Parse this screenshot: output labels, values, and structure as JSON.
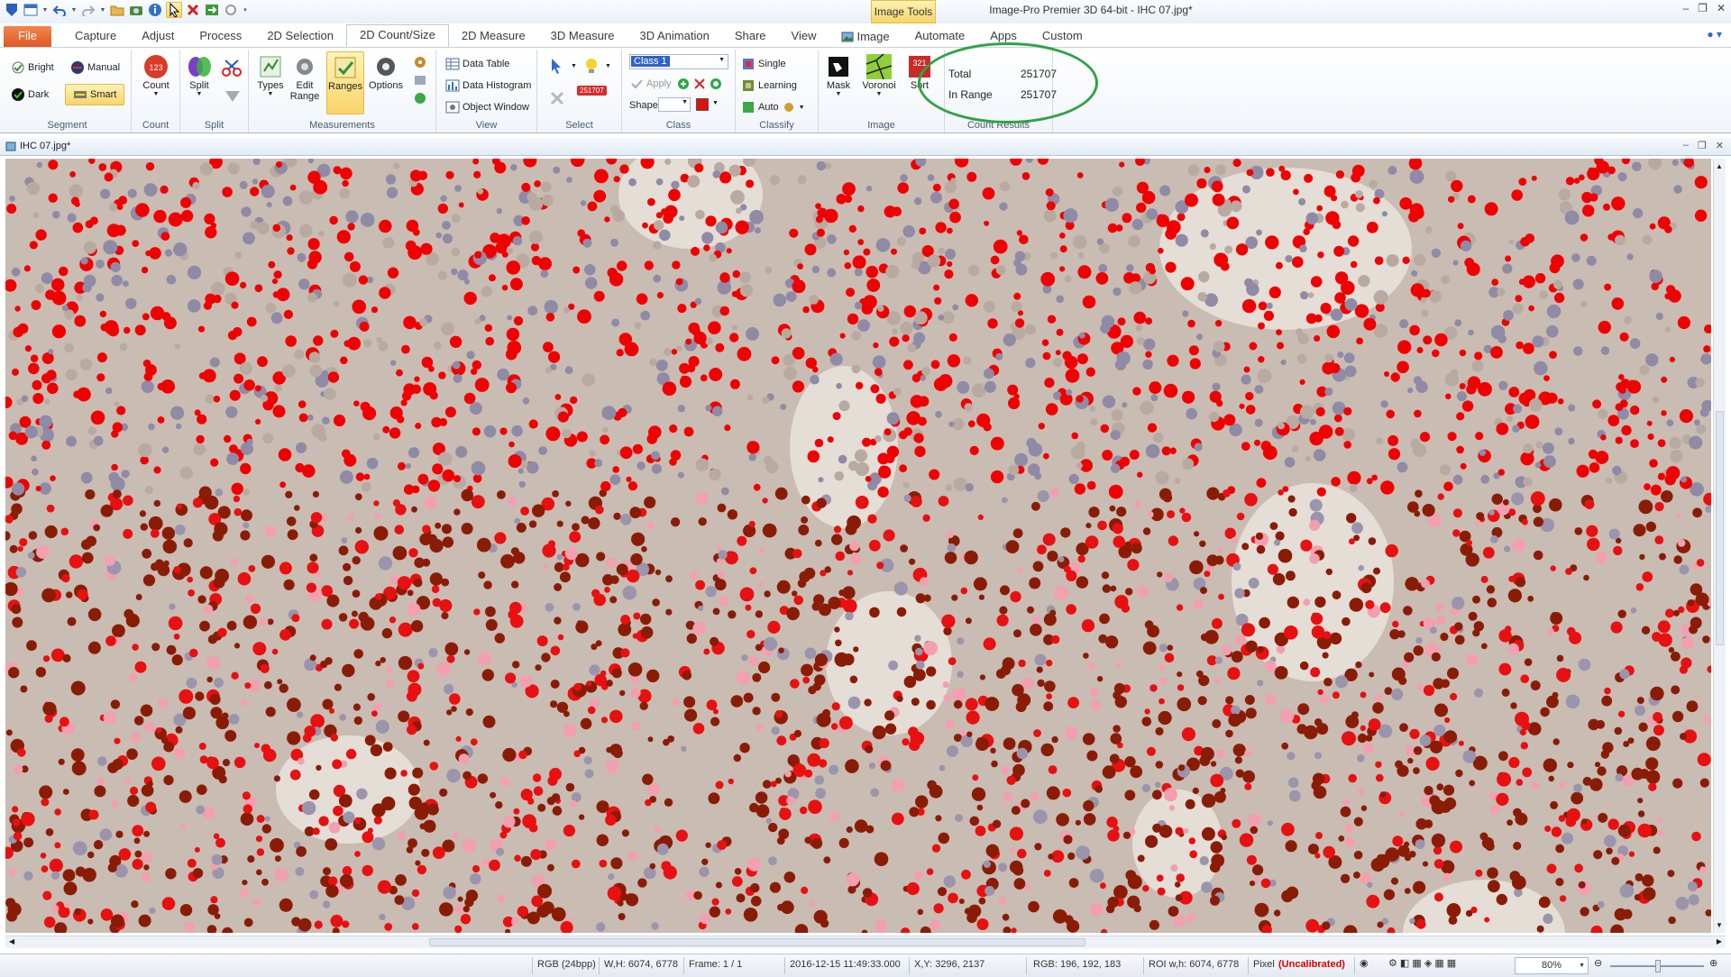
{
  "window": {
    "title": "Image-Pro  Premier  3D  64-bit  -  IHC  07.jpg*",
    "context_tab_header": "Image Tools"
  },
  "ribbon_tabs": [
    "File",
    "Capture",
    "Adjust",
    "Process",
    "2D Selection",
    "2D Count/Size",
    "2D Measure",
    "3D Measure",
    "3D Animation",
    "Share",
    "View",
    "Image",
    "Automate",
    "Apps",
    "Custom"
  ],
  "active_tab": "2D Count/Size",
  "groups": {
    "segment": {
      "label": "Segment",
      "bright": "Bright",
      "manual": "Manual",
      "dark": "Dark",
      "smart": "Smart"
    },
    "count": {
      "label": "Count",
      "count": "Count"
    },
    "split": {
      "label": "Split",
      "split": "Split"
    },
    "measurements": {
      "label": "Measurements",
      "types": "Types",
      "edit_range_1": "Edit",
      "edit_range_2": "Range",
      "ranges": "Ranges",
      "options": "Options"
    },
    "view": {
      "label": "View",
      "data_table": "Data Table",
      "data_histogram": "Data Histogram",
      "object_window": "Object Window"
    },
    "select": {
      "label": "Select",
      "count_badge": "251707"
    },
    "class": {
      "label": "Class",
      "class_value": "Class 1",
      "apply": "Apply",
      "shape": "Shape",
      "color": "#e01010"
    },
    "classify": {
      "label": "Classify",
      "single": "Single",
      "learning": "Learning",
      "auto": "Auto"
    },
    "image": {
      "label": "Image",
      "mask": "Mask",
      "voronoi": "Voronoi",
      "sort": "Sort"
    },
    "count_results": {
      "label": "Count Results",
      "total_label": "Total",
      "total_value": "251707",
      "inrange_label": "In Range",
      "inrange_value": "251707"
    }
  },
  "document": {
    "title": "IHC 07.jpg*"
  },
  "status_bar": {
    "color_mode": "RGB (24bpp)",
    "dimensions": "W,H: 6074, 6778",
    "frame": "Frame: 1 / 1",
    "timestamp": "2016-12-15 11:49:33.000",
    "xy": "X,Y: 3296, 2137",
    "rgb": "RGB:  196,  192,  183",
    "roi": "ROI w,h: 6074, 6778",
    "pixel_label": "Pixel",
    "calibration": "(Uncalibrated)",
    "zoom": "80%"
  },
  "colors": {
    "accent": "#df5a22",
    "highlight": "#f9d36a",
    "annotation": "#2fa346",
    "nucleus_red": "#f00000",
    "nucleus_brown": "#8a1c06"
  }
}
